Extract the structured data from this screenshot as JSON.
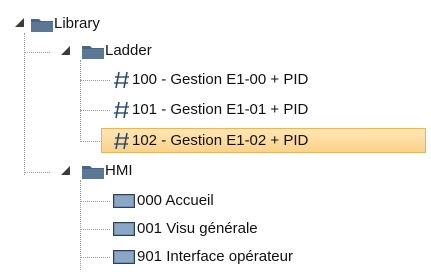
{
  "tree": {
    "root": {
      "label": "Library",
      "icon": "folder-icon",
      "children": [
        {
          "label": "Ladder",
          "icon": "folder-icon",
          "items": [
            {
              "label": "100 - Gestion E1-00 + PID",
              "icon": "ladder-icon",
              "selected": false
            },
            {
              "label": "101 - Gestion E1-01 + PID",
              "icon": "ladder-icon",
              "selected": false
            },
            {
              "label": "102 - Gestion E1-02 + PID",
              "icon": "ladder-icon",
              "selected": true
            }
          ]
        },
        {
          "label": "HMI",
          "icon": "folder-icon",
          "items": [
            {
              "label": "000 Accueil",
              "icon": "screen-icon"
            },
            {
              "label": "001 Visu générale",
              "icon": "screen-icon"
            },
            {
              "label": "901 Interface opérateur",
              "icon": "screen-icon"
            }
          ]
        }
      ]
    }
  },
  "colors": {
    "folder": "#4a6580",
    "screen_fill": "#6f8fb2",
    "ladder": "#2d4b6e",
    "selection_fill": "#fbd28b",
    "selection_border": "#e8b55c"
  }
}
